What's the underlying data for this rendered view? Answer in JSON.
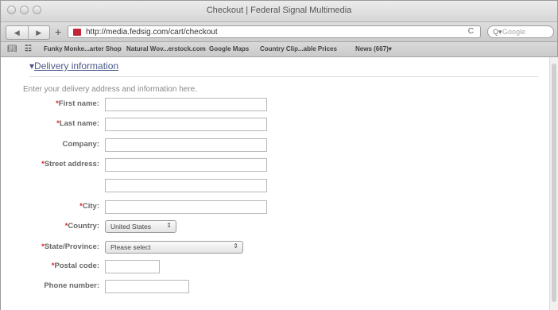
{
  "window": {
    "title": "Checkout | Federal Signal Multimedia"
  },
  "toolbar": {
    "back": "◀",
    "forward": "▶",
    "add": "+",
    "url": "http://media.fedsig.com/cart/checkout",
    "reload": "C",
    "search_icon": "Q▾",
    "search_placeholder": "Google"
  },
  "bookmarks": {
    "icons": [
      "book-icon",
      "grid-icon"
    ],
    "items": [
      "Funky Monke...arter Shop",
      "Natural Wov...erstock.com",
      "Google Maps",
      "Country Clip...able Prices",
      "News (667)▾"
    ]
  },
  "section": {
    "toggle": "▾",
    "title": "Delivery information"
  },
  "intro": "Enter your delivery address and information here.",
  "form": {
    "first_name": "First name:",
    "last_name": "Last name:",
    "company": "Company:",
    "street": "Street address:",
    "city": "City:",
    "country": "Country:",
    "country_value": "United States",
    "state": "State/Province:",
    "state_value": "Please select",
    "postal": "Postal code:",
    "phone": "Phone number:",
    "required_mark": "*"
  }
}
